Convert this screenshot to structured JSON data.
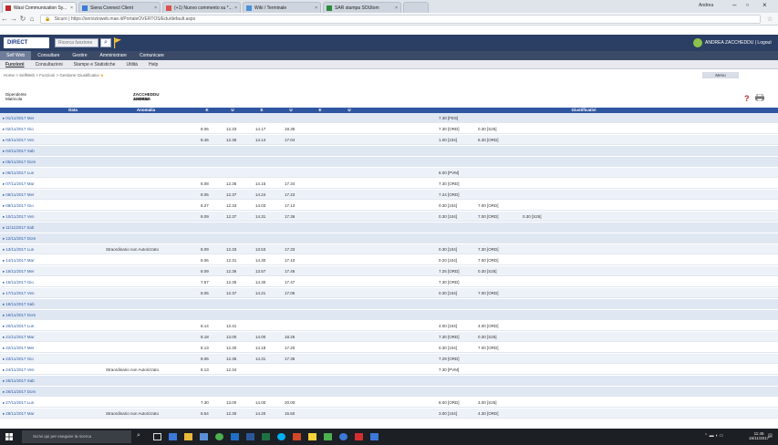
{
  "browser": {
    "tabs": [
      {
        "label": "Wasi Communication Sy..."
      },
      {
        "label": "Siena Connect Client"
      },
      {
        "label": "(+1) Nuovo commento su *..."
      },
      {
        "label": "Wiki / Terminale"
      },
      {
        "label": "SAR stampa SOUtom"
      },
      {
        "label": ""
      }
    ],
    "user_chip": "Andrea",
    "url_prefix": "Sicuro",
    "url": "https://servizioweb.mae.it/PortaleOVERTOS/Edu/default.aspx"
  },
  "app": {
    "logo": "DIRECT",
    "search_placeholder": "Ricerca funzione",
    "user_name": "ANDREA ZACCHEDDU | Logout",
    "top_menu": [
      "Self Web",
      "Consultare",
      "Gestire",
      "Amministrare",
      "Comunicare"
    ],
    "sub_menu": [
      "Funzioni",
      "Consultazioni",
      "Stampe e Statistiche",
      "Utilità",
      "Help"
    ],
    "breadcrumb": "Home > SelfWeb > Funzioni > Gestione Giustificativi",
    "menu_button": "Menu"
  },
  "employee": {
    "dipendente_label": "Dipendente",
    "dipendente_value": "ZACCHEDDU ANDREA",
    "matricola_label": "Matricola",
    "matricola_value": "1200434"
  },
  "table": {
    "headers": [
      "Data",
      "Anomalia",
      "E",
      "U",
      "E",
      "U",
      "E",
      "U",
      "Giustificativi"
    ],
    "rows": [
      {
        "date": "01/11/2017 Mer",
        "anomaly": "",
        "e1": "",
        "u1": "",
        "e2": "",
        "u2": "",
        "g1": "7.30 [FES]",
        "g2": "",
        "g3": "",
        "type": "wknd"
      },
      {
        "date": "02/11/2017 Gio",
        "anomaly": "",
        "e1": "8.06",
        "u1": "12.33",
        "e2": "14.17",
        "u2": "18.35",
        "g1": "7.30 [ORD]",
        "g2": "0.30 [S25]",
        "g3": "",
        "type": "norm"
      },
      {
        "date": "03/11/2017 Ven",
        "anomaly": "",
        "e1": "8.46",
        "u1": "12.35",
        "e2": "14.14",
        "u2": "17.04",
        "g1": "1.00 [104]",
        "g2": "6.30 [ORD]",
        "g3": "",
        "type": "alt"
      },
      {
        "date": "04/11/2017 Sab",
        "anomaly": "",
        "e1": "",
        "u1": "",
        "e2": "",
        "u2": "",
        "g1": "",
        "g2": "",
        "g3": "",
        "type": "wknd"
      },
      {
        "date": "05/11/2017 Dom",
        "anomaly": "",
        "e1": "",
        "u1": "",
        "e2": "",
        "u2": "",
        "g1": "",
        "g2": "",
        "g3": "",
        "type": "wknd"
      },
      {
        "date": "06/11/2017 Lun",
        "anomaly": "",
        "e1": "",
        "u1": "",
        "e2": "",
        "u2": "",
        "g1": "6.00 [PVM]",
        "g2": "",
        "g3": "",
        "type": "alt"
      },
      {
        "date": "07/11/2017 Mar",
        "anomaly": "",
        "e1": "8.08",
        "u1": "12.36",
        "e2": "14.15",
        "u2": "17.34",
        "g1": "7.30 [ORD]",
        "g2": "",
        "g3": "",
        "type": "norm"
      },
      {
        "date": "08/11/2017 Mer",
        "anomaly": "",
        "e1": "8.05",
        "u1": "12.37",
        "e2": "14.24",
        "u2": "17.23",
        "g1": "7.24 [ORD]",
        "g2": "",
        "g3": "",
        "type": "alt"
      },
      {
        "date": "09/11/2017 Gio",
        "anomaly": "",
        "e1": "8.27",
        "u1": "12.33",
        "e2": "14.03",
        "u2": "17.13",
        "g1": "0.30 [104]",
        "g2": "7.00 [ORD]",
        "g3": "",
        "type": "norm"
      },
      {
        "date": "10/11/2017 Ven",
        "anomaly": "",
        "e1": "8.09",
        "u1": "12.37",
        "e2": "14.31",
        "u2": "17.36",
        "g1": "0.30 [104]",
        "g2": "7.00 [ORD]",
        "g3": "0.30 [S25]",
        "type": "alt"
      },
      {
        "date": "11/11/2017 Sab",
        "anomaly": "",
        "e1": "",
        "u1": "",
        "e2": "",
        "u2": "",
        "g1": "",
        "g2": "",
        "g3": "",
        "type": "wknd"
      },
      {
        "date": "12/11/2017 Dom",
        "anomaly": "",
        "e1": "",
        "u1": "",
        "e2": "",
        "u2": "",
        "g1": "",
        "g2": "",
        "g3": "",
        "type": "wknd"
      },
      {
        "date": "13/11/2017 Lun",
        "anomaly": "Straordinario non Autorizzato",
        "e1": "8.09",
        "u1": "12.33",
        "e2": "13.53",
        "u2": "17.33",
        "g1": "0.30 [104]",
        "g2": "7.30 [ORD]",
        "g3": "",
        "type": "alt"
      },
      {
        "date": "14/11/2017 Mar",
        "anomaly": "",
        "e1": "8.06",
        "u1": "12.31",
        "e2": "14.30",
        "u2": "17.10",
        "g1": "0.20 [104]",
        "g2": "7.00 [ORD]",
        "g3": "",
        "type": "norm"
      },
      {
        "date": "15/11/2017 Mer",
        "anomaly": "",
        "e1": "8.09",
        "u1": "12.36",
        "e2": "13.57",
        "u2": "17.46",
        "g1": "7.25 [ORD]",
        "g2": "0.30 [S25]",
        "g3": "",
        "type": "alt"
      },
      {
        "date": "16/11/2017 Gio",
        "anomaly": "",
        "e1": "7.57",
        "u1": "12.35",
        "e2": "14.30",
        "u2": "17.47",
        "g1": "7.30 [ORD]",
        "g2": "",
        "g3": "",
        "type": "norm"
      },
      {
        "date": "17/11/2017 Ven",
        "anomaly": "",
        "e1": "8.05",
        "u1": "12.37",
        "e2": "14.21",
        "u2": "17.06",
        "g1": "0.30 [104]",
        "g2": "7.00 [ORD]",
        "g3": "",
        "type": "alt"
      },
      {
        "date": "18/11/2017 Sab",
        "anomaly": "",
        "e1": "",
        "u1": "",
        "e2": "",
        "u2": "",
        "g1": "",
        "g2": "",
        "g3": "",
        "type": "wknd"
      },
      {
        "date": "19/11/2017 Dom",
        "anomaly": "",
        "e1": "",
        "u1": "",
        "e2": "",
        "u2": "",
        "g1": "",
        "g2": "",
        "g3": "",
        "type": "wknd"
      },
      {
        "date": "20/11/2017 Lun",
        "anomaly": "",
        "e1": "8.14",
        "u1": "12.41",
        "e2": "",
        "u2": "",
        "g1": "4.00 [104]",
        "g2": "4.00 [ORD]",
        "g3": "",
        "type": "norm"
      },
      {
        "date": "21/11/2017 Mar",
        "anomaly": "",
        "e1": "8.18",
        "u1": "13.00",
        "e2": "14.00",
        "u2": "18.26",
        "g1": "7.30 [ORD]",
        "g2": "0.30 [S25]",
        "g3": "",
        "type": "alt"
      },
      {
        "date": "22/11/2017 Mer",
        "anomaly": "",
        "e1": "8.13",
        "u1": "12.30",
        "e2": "14.18",
        "u2": "17.20",
        "g1": "0.30 [104]",
        "g2": "7.00 [ORD]",
        "g3": "",
        "type": "norm"
      },
      {
        "date": "23/11/2017 Gio",
        "anomaly": "",
        "e1": "8.06",
        "u1": "12.35",
        "e2": "14.31",
        "u2": "17.36",
        "g1": "7.29 [ORD]",
        "g2": "",
        "g3": "",
        "type": "alt"
      },
      {
        "date": "24/11/2017 Ven",
        "anomaly": "Straordinario non Autorizzato",
        "e1": "8.13",
        "u1": "12.34",
        "e2": "",
        "u2": "",
        "g1": "7.30 [PVM]",
        "g2": "",
        "g3": "",
        "type": "norm"
      },
      {
        "date": "25/11/2017 Sab",
        "anomaly": "",
        "e1": "",
        "u1": "",
        "e2": "",
        "u2": "",
        "g1": "",
        "g2": "",
        "g3": "",
        "type": "wknd"
      },
      {
        "date": "26/11/2017 Dom",
        "anomaly": "",
        "e1": "",
        "u1": "",
        "e2": "",
        "u2": "",
        "g1": "",
        "g2": "",
        "g3": "",
        "type": "wknd"
      },
      {
        "date": "27/11/2017 Lun",
        "anomaly": "",
        "e1": "7.30",
        "u1": "13.00",
        "e2": "14.00",
        "u2": "20.00",
        "g1": "8.00 [ORD]",
        "g2": "3.00 [S25]",
        "g3": "",
        "type": "norm"
      },
      {
        "date": "28/11/2017 Mar",
        "anomaly": "Straordinario non Autorizzato",
        "e1": "8.54",
        "u1": "12.30",
        "e2": "14.20",
        "u2": "15.50",
        "g1": "3.00 [104]",
        "g2": "4.30 [ORD]",
        "g3": "",
        "type": "alt"
      }
    ]
  },
  "taskbar": {
    "search_placeholder": "Scrivi qui per eseguire la ricerca",
    "time": "11:45",
    "date": "15/11/2017"
  }
}
